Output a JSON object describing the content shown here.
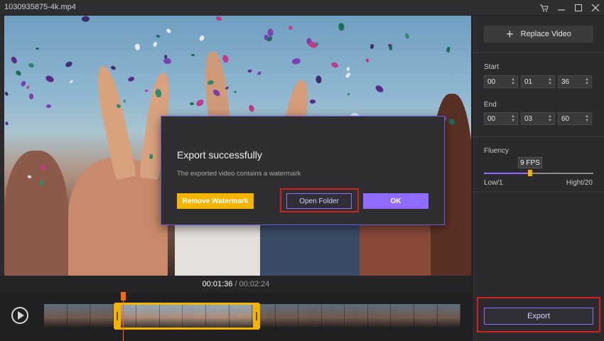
{
  "window": {
    "title": "1030935875-4k.mp4",
    "controls": [
      "cart-icon",
      "minimize-icon",
      "maximize-icon",
      "close-icon"
    ]
  },
  "preview": {
    "current_time": "00:01:36",
    "separator": "/",
    "total_time": "00:02:24"
  },
  "timeline": {
    "play_icon": "play-icon",
    "frame_count": 18,
    "selection_start_fraction": 0.17,
    "selection_end_fraction": 0.52,
    "playhead_fraction": 0.19
  },
  "panel": {
    "replace_label": "Replace Video",
    "start_label": "Start",
    "start": [
      "00",
      "01",
      "36"
    ],
    "end_label": "End",
    "end": [
      "00",
      "03",
      "60"
    ],
    "fluency_label": "Fluency",
    "fps_value": "9 FPS",
    "fps_fraction": 0.42,
    "low_label": "Low/1",
    "high_label": "Hight/20",
    "export_label": "Export"
  },
  "dialog": {
    "title": "Export successfully",
    "message": "The exported video contains a watermark",
    "remove_label": "Remove Watermark",
    "open_label": "Open Folder",
    "ok_label": "OK"
  },
  "colors": {
    "accent": "#8f6bff",
    "yellow": "#f3b400",
    "highlight_red": "#d02020"
  }
}
